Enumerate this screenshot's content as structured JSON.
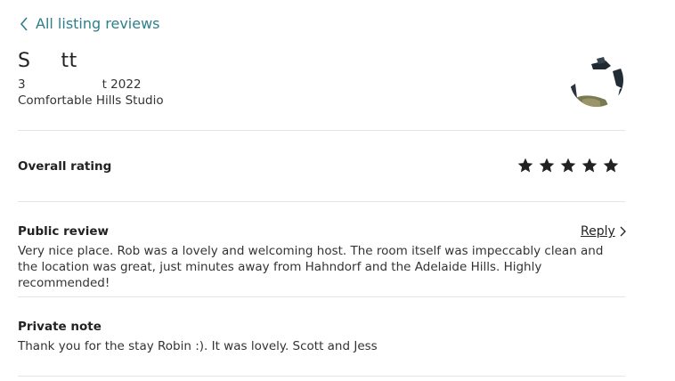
{
  "nav": {
    "back_label": "All listing reviews"
  },
  "review": {
    "guest_name_start": "S",
    "guest_name_end": "tt",
    "date_start": "3",
    "date_end": "t 2022",
    "listing_name": "Comfortable Hills Studio"
  },
  "overall": {
    "title": "Overall rating",
    "stars": 5,
    "max_stars": 5
  },
  "public_review": {
    "title": "Public review",
    "reply_label": "Reply",
    "text": "Very nice place. Rob was a lovely and welcoming host. The room itself was impeccably clean and the location was great, just minutes away from Hahndorf and the Adelaide Hills. Highly recommended!"
  },
  "private_note": {
    "title": "Private note",
    "text": "Thank you for the stay Robin :). It was lovely. Scott and Jess"
  },
  "colors": {
    "link": "#2e7f8a",
    "star": "#222222",
    "divider": "#e4e4e4"
  },
  "icons": {
    "back": "chevron-left-icon",
    "reply": "chevron-right-icon",
    "star": "star-icon"
  }
}
